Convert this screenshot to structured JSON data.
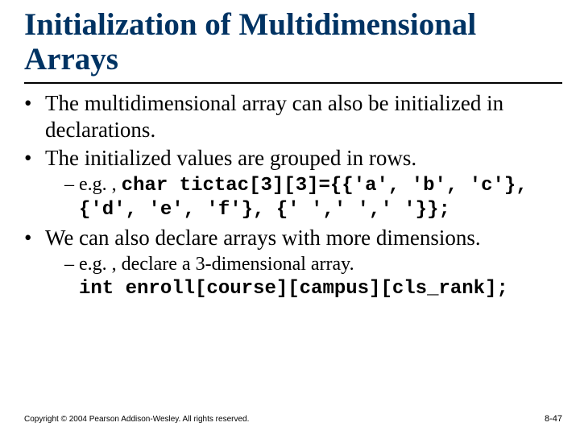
{
  "title": "Initialization of Multidimensional Arrays",
  "bullets": {
    "b1": "The multidimensional array can also be initialized in declarations.",
    "b2": "The initialized values are grouped in rows.",
    "b2_sub_prefix": "e.g. , ",
    "b2_sub_code": "char tictac[3][3]={{'a', 'b', 'c'}, {'d', 'e', 'f'}, {' ',' ',' '}};",
    "b3": "We can also declare arrays with more dimensions.",
    "b3_sub_line1": "e.g. , declare a 3-dimensional array.",
    "b3_sub_code": "int enroll[course][campus][cls_rank];"
  },
  "footer": {
    "left": "Copyright © 2004 Pearson Addison-Wesley. All rights reserved.",
    "right": "8-47"
  }
}
